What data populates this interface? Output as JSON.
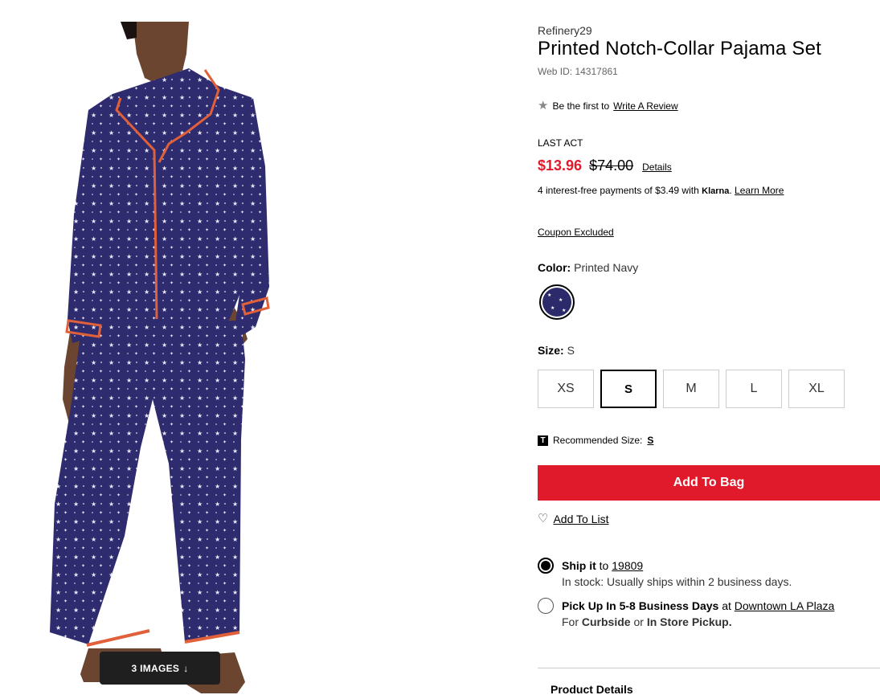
{
  "product": {
    "brand": "Refinery29",
    "title": "Printed Notch-Collar Pajama Set",
    "web_id": "Web ID: 14317861"
  },
  "review": {
    "star_icon": "star-icon",
    "text": "Be the first to",
    "link": "Write A Review"
  },
  "pricing": {
    "promo_label": "LAST ACT",
    "sale_price": "$13.96",
    "original_price": "$74.00",
    "details_link": "Details",
    "sale_color": "#e11a2b",
    "klarna_text": "4 interest-free payments of $3.49 with",
    "klarna_brand": "Klarna",
    "klarna_link": "Learn More",
    "coupon": "Coupon Excluded"
  },
  "color": {
    "label": "Color:",
    "value": "Printed Navy",
    "swatch_color": "#2d2a6b"
  },
  "size": {
    "label": "Size:",
    "value": "S",
    "options": [
      "XS",
      "S",
      "M",
      "L",
      "XL"
    ],
    "selected": "S",
    "recommended_icon": "T",
    "recommended_label": "Recommended Size:",
    "recommended_value": "S"
  },
  "actions": {
    "add_to_bag": "Add To Bag",
    "add_to_list": "Add To List",
    "heart_icon": "heart-outline-icon",
    "button_color": "#e11a2b"
  },
  "shipping": {
    "ship_bold": "Ship it",
    "ship_to": "to",
    "zip": "19809",
    "ship_stock": "In stock: Usually ships within 2 business days.",
    "pickup_bold": "Pick Up In 5-8 Business Days",
    "pickup_at": "at",
    "store": "Downtown LA Plaza",
    "pickup_for": "For",
    "curbside": "Curbside",
    "or": "or",
    "in_store": "In Store Pickup."
  },
  "gallery": {
    "images_button": "3 IMAGES",
    "arrow_icon": "arrow-down-icon"
  },
  "sections": {
    "product_details": "Product Details"
  }
}
